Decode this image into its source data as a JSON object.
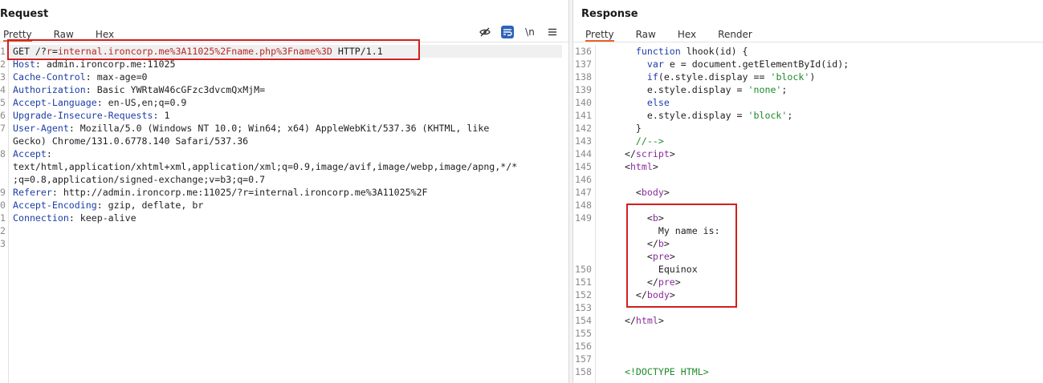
{
  "request": {
    "title": "Request",
    "tabs": [
      "Pretty",
      "Raw",
      "Hex"
    ],
    "lines": [
      {
        "n": "1",
        "parts": [
          {
            "c": "black",
            "t": "GET /?"
          },
          {
            "c": "red",
            "t": "r"
          },
          {
            "c": "black",
            "t": "="
          },
          {
            "c": "red",
            "t": "internal.ironcorp.me%3A11025%2Fname.php%3Fname%3D"
          },
          {
            "c": "black",
            "t": " HTTP/1.1"
          }
        ]
      },
      {
        "n": "2",
        "parts": [
          {
            "c": "blue",
            "t": "Host"
          },
          {
            "c": "black",
            "t": ": admin.ironcorp.me:11025"
          }
        ]
      },
      {
        "n": "3",
        "parts": [
          {
            "c": "blue",
            "t": "Cache-Control"
          },
          {
            "c": "black",
            "t": ": max-age=0"
          }
        ]
      },
      {
        "n": "4",
        "parts": [
          {
            "c": "blue",
            "t": "Authorization"
          },
          {
            "c": "black",
            "t": ": Basic YWRtaW46cGFzc3dvcmQxMjM="
          }
        ]
      },
      {
        "n": "5",
        "parts": [
          {
            "c": "blue",
            "t": "Accept-Language"
          },
          {
            "c": "black",
            "t": ": en-US,en;q=0.9"
          }
        ]
      },
      {
        "n": "6",
        "parts": [
          {
            "c": "blue",
            "t": "Upgrade-Insecure-Requests"
          },
          {
            "c": "black",
            "t": ": 1"
          }
        ]
      },
      {
        "n": "7",
        "parts": [
          {
            "c": "blue",
            "t": "User-Agent"
          },
          {
            "c": "black",
            "t": ": Mozilla/5.0 (Windows NT 10.0; Win64; x64) AppleWebKit/537.36 (KHTML, like"
          }
        ]
      },
      {
        "n": "",
        "parts": [
          {
            "c": "black",
            "t": "Gecko) Chrome/131.0.6778.140 Safari/537.36"
          }
        ]
      },
      {
        "n": "8",
        "parts": [
          {
            "c": "blue",
            "t": "Accept"
          },
          {
            "c": "black",
            "t": ":"
          }
        ]
      },
      {
        "n": "",
        "parts": [
          {
            "c": "black",
            "t": "text/html,application/xhtml+xml,application/xml;q=0.9,image/avif,image/webp,image/apng,*/*"
          }
        ]
      },
      {
        "n": "",
        "parts": [
          {
            "c": "black",
            "t": ";q=0.8,application/signed-exchange;v=b3;q=0.7"
          }
        ]
      },
      {
        "n": "9",
        "parts": [
          {
            "c": "blue",
            "t": "Referer"
          },
          {
            "c": "black",
            "t": ": http://admin.ironcorp.me:11025/?r=internal.ironcorp.me%3A11025%2F"
          }
        ]
      },
      {
        "n": "0",
        "parts": [
          {
            "c": "blue",
            "t": "Accept-Encoding"
          },
          {
            "c": "black",
            "t": ": gzip, deflate, br"
          }
        ]
      },
      {
        "n": "1",
        "parts": [
          {
            "c": "blue",
            "t": "Connection"
          },
          {
            "c": "black",
            "t": ": keep-alive"
          }
        ]
      },
      {
        "n": "2",
        "parts": []
      },
      {
        "n": "3",
        "parts": []
      }
    ]
  },
  "response": {
    "title": "Response",
    "tabs": [
      "Pretty",
      "Raw",
      "Hex",
      "Render"
    ],
    "lines": [
      {
        "n": "136",
        "parts": [
          {
            "c": "black",
            "t": "    "
          },
          {
            "c": "blue",
            "t": "function"
          },
          {
            "c": "black",
            "t": " lhook(id) {"
          }
        ]
      },
      {
        "n": "137",
        "parts": [
          {
            "c": "black",
            "t": "      "
          },
          {
            "c": "blue",
            "t": "var"
          },
          {
            "c": "black",
            "t": " e = document.getElementById(id);"
          }
        ]
      },
      {
        "n": "138",
        "parts": [
          {
            "c": "black",
            "t": "      "
          },
          {
            "c": "blue",
            "t": "if"
          },
          {
            "c": "black",
            "t": "(e.style.display == "
          },
          {
            "c": "green",
            "t": "'block'"
          },
          {
            "c": "black",
            "t": ")"
          }
        ]
      },
      {
        "n": "139",
        "parts": [
          {
            "c": "black",
            "t": "      e.style.display = "
          },
          {
            "c": "green",
            "t": "'none'"
          },
          {
            "c": "black",
            "t": ";"
          }
        ]
      },
      {
        "n": "140",
        "parts": [
          {
            "c": "black",
            "t": "      "
          },
          {
            "c": "blue",
            "t": "else"
          }
        ]
      },
      {
        "n": "141",
        "parts": [
          {
            "c": "black",
            "t": "      e.style.display = "
          },
          {
            "c": "green",
            "t": "'block'"
          },
          {
            "c": "black",
            "t": ";"
          }
        ]
      },
      {
        "n": "142",
        "parts": [
          {
            "c": "black",
            "t": "    }"
          }
        ]
      },
      {
        "n": "143",
        "parts": [
          {
            "c": "black",
            "t": "    "
          },
          {
            "c": "green",
            "t": "//-->"
          }
        ]
      },
      {
        "n": "144",
        "parts": [
          {
            "c": "black",
            "t": "  </"
          },
          {
            "c": "purple",
            "t": "script"
          },
          {
            "c": "black",
            "t": ">"
          }
        ]
      },
      {
        "n": "145",
        "parts": [
          {
            "c": "black",
            "t": "  <"
          },
          {
            "c": "purple",
            "t": "html"
          },
          {
            "c": "black",
            "t": ">"
          }
        ]
      },
      {
        "n": "146",
        "parts": []
      },
      {
        "n": "147",
        "parts": [
          {
            "c": "black",
            "t": "    <"
          },
          {
            "c": "purple",
            "t": "body"
          },
          {
            "c": "black",
            "t": ">"
          }
        ]
      },
      {
        "n": "148",
        "parts": []
      },
      {
        "n": "149",
        "parts": [
          {
            "c": "black",
            "t": "      <"
          },
          {
            "c": "purple",
            "t": "b"
          },
          {
            "c": "black",
            "t": ">"
          }
        ]
      },
      {
        "n": "",
        "parts": [
          {
            "c": "black",
            "t": "        My name is:"
          }
        ]
      },
      {
        "n": "",
        "parts": [
          {
            "c": "black",
            "t": "      </"
          },
          {
            "c": "purple",
            "t": "b"
          },
          {
            "c": "black",
            "t": ">"
          }
        ]
      },
      {
        "n": "",
        "parts": [
          {
            "c": "black",
            "t": "      <"
          },
          {
            "c": "purple",
            "t": "pre"
          },
          {
            "c": "black",
            "t": ">"
          }
        ]
      },
      {
        "n": "150",
        "parts": [
          {
            "c": "black",
            "t": "        Equinox"
          }
        ]
      },
      {
        "n": "151",
        "parts": [
          {
            "c": "black",
            "t": "      </"
          },
          {
            "c": "purple",
            "t": "pre"
          },
          {
            "c": "black",
            "t": ">"
          }
        ]
      },
      {
        "n": "152",
        "parts": [
          {
            "c": "black",
            "t": "    </"
          },
          {
            "c": "purple",
            "t": "body"
          },
          {
            "c": "black",
            "t": ">"
          }
        ]
      },
      {
        "n": "153",
        "parts": []
      },
      {
        "n": "154",
        "parts": [
          {
            "c": "black",
            "t": "  </"
          },
          {
            "c": "purple",
            "t": "html"
          },
          {
            "c": "black",
            "t": ">"
          }
        ]
      },
      {
        "n": "155",
        "parts": []
      },
      {
        "n": "156",
        "parts": []
      },
      {
        "n": "157",
        "parts": []
      },
      {
        "n": "158",
        "parts": [
          {
            "c": "black",
            "t": "  "
          },
          {
            "c": "green",
            "t": "<!DOCTYPE HTML>"
          }
        ]
      }
    ]
  },
  "colors": {
    "accent": "#e8612c",
    "highlight": "#d11f1f",
    "tool_blue": "#2e63b8"
  }
}
